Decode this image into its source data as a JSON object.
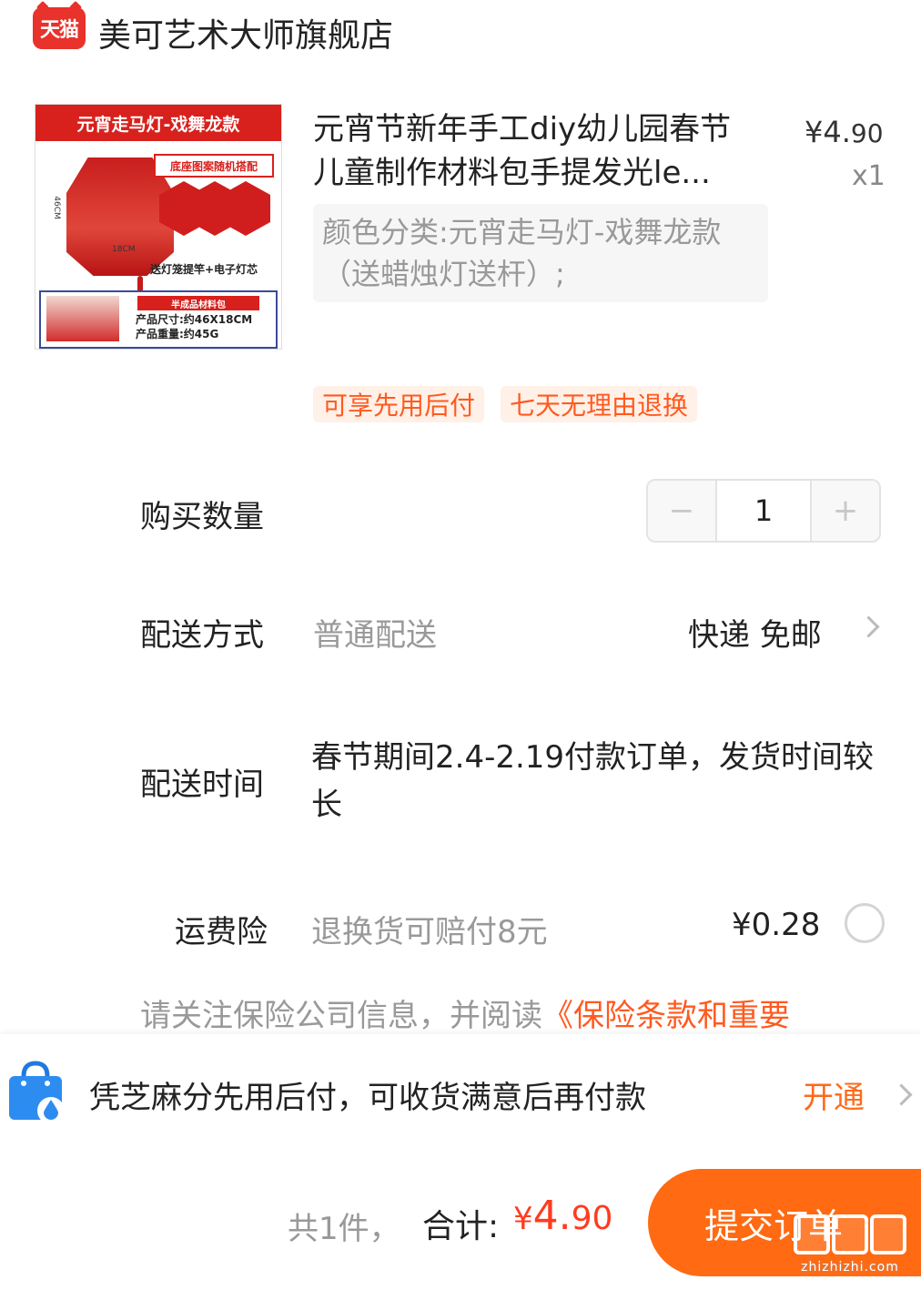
{
  "store": {
    "logo_text": "天猫",
    "name": "美可艺术大师旗舰店"
  },
  "product": {
    "image": {
      "banner": "元宵走马灯-戏舞龙款",
      "tag": "底座图案随机搭配",
      "caption": "送灯笼提竿+电子灯芯",
      "dim_height": "46CM",
      "dim_width": "18CM",
      "pill": "半成品材料包",
      "spec_size": "产品尺寸:约46X18CM",
      "spec_weight": "产品重量:约45G"
    },
    "title": "元宵节新年手工diy幼儿园春节儿童制作材料包手提发光le...",
    "price_symbol": "¥",
    "price_int": "4.",
    "price_dec": "90",
    "quantity_label": "x1",
    "sku": "颜色分类:元宵走马灯-戏舞龙款（送蜡烛灯送杆）;",
    "badges": [
      "可享先用后付",
      "七天无理由退换"
    ]
  },
  "quantity": {
    "label": "购买数量",
    "minus": "−",
    "value": "1",
    "plus": "+"
  },
  "shipping": {
    "label": "配送方式",
    "method": "普通配送",
    "value": "快递 免邮"
  },
  "delivery_time": {
    "label": "配送时间",
    "text": "春节期间2.4-2.19付款订单，发货时间较长"
  },
  "insurance": {
    "label": "运费险",
    "desc": "退换货可赔付8元",
    "price": "¥0.28",
    "notice": "请关注保险公司信息，并阅读",
    "notice_link": "《保险条款和重要"
  },
  "pay_later": {
    "text": "凭芝麻分先用后付，可收货满意后再付款",
    "action": "开通"
  },
  "footer": {
    "count": "共1件，",
    "total_label": "合计:",
    "total_symbol": "¥",
    "total_int": "4.",
    "total_dec": "90",
    "submit": "提交订单"
  },
  "watermark": {
    "text": "值值值",
    "url": "zhizhizhi.com"
  },
  "colors": {
    "accent": "#ff6a12",
    "price_red": "#ff3b1f",
    "tmall_red": "#e8322b",
    "badge_bg": "#fff0e8"
  }
}
